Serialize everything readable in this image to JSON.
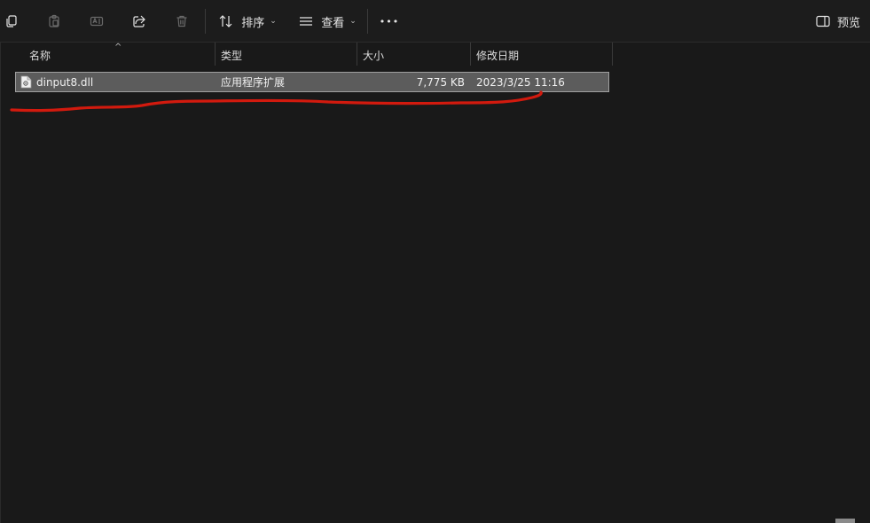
{
  "toolbar": {
    "sort_label": "排序",
    "view_label": "查看",
    "more_label": "•••",
    "preview_label": "预览"
  },
  "columns": {
    "name": "名称",
    "type": "类型",
    "size": "大小",
    "modified": "修改日期"
  },
  "files": [
    {
      "name": "dinput8.dll",
      "type": "应用程序扩展",
      "size": "7,775 KB",
      "modified": "2023/3/25 11:16"
    }
  ],
  "colors": {
    "accent_red": "#d21a0e",
    "row_selected": "#5c5c5c"
  }
}
